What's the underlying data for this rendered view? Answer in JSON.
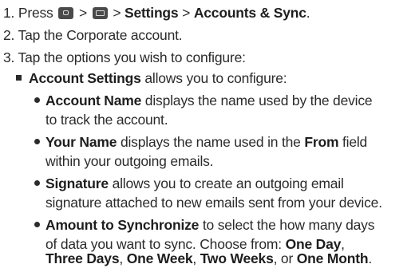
{
  "step1": {
    "num": "1. Press",
    "sep1": ">",
    "sep2": ">",
    "settings": "Settings",
    "sep3": ">",
    "accounts": "Accounts & Sync",
    "period": ".",
    "icons": [
      "home-key-icon",
      "menu-key-icon"
    ]
  },
  "step2": "2. Tap the Corporate account.",
  "step3": "3. Tap the options you wish to configure:",
  "account_settings": {
    "bold": "Account Settings",
    "rest": " allows you to configure:"
  },
  "items": {
    "name": {
      "bold": "Account Name",
      "line1": " displays the name used by the device",
      "line2": "to track the account."
    },
    "your_name": {
      "bold": "Your Name",
      "line1a": " displays the name used in the ",
      "from": "From",
      "line1b": " field",
      "line2": "within your outgoing emails."
    },
    "signature": {
      "bold": "Signature",
      "line1": " allows you to create an outgoing email",
      "line2": "signature attached to new emails sent from your device."
    },
    "sync": {
      "bold": "Amount to Synchronize",
      "line1": " to select the how many days",
      "line2a": "of data you want to sync. Choose from: ",
      "one_day": "One Day",
      "comma1": ",",
      "three_days": "Three Days",
      "comma2": ", ",
      "one_week": "One Week",
      "comma3": ", ",
      "two_weeks": "Two Weeks",
      "or": ", or ",
      "one_month": "One Month",
      "end": "."
    }
  }
}
